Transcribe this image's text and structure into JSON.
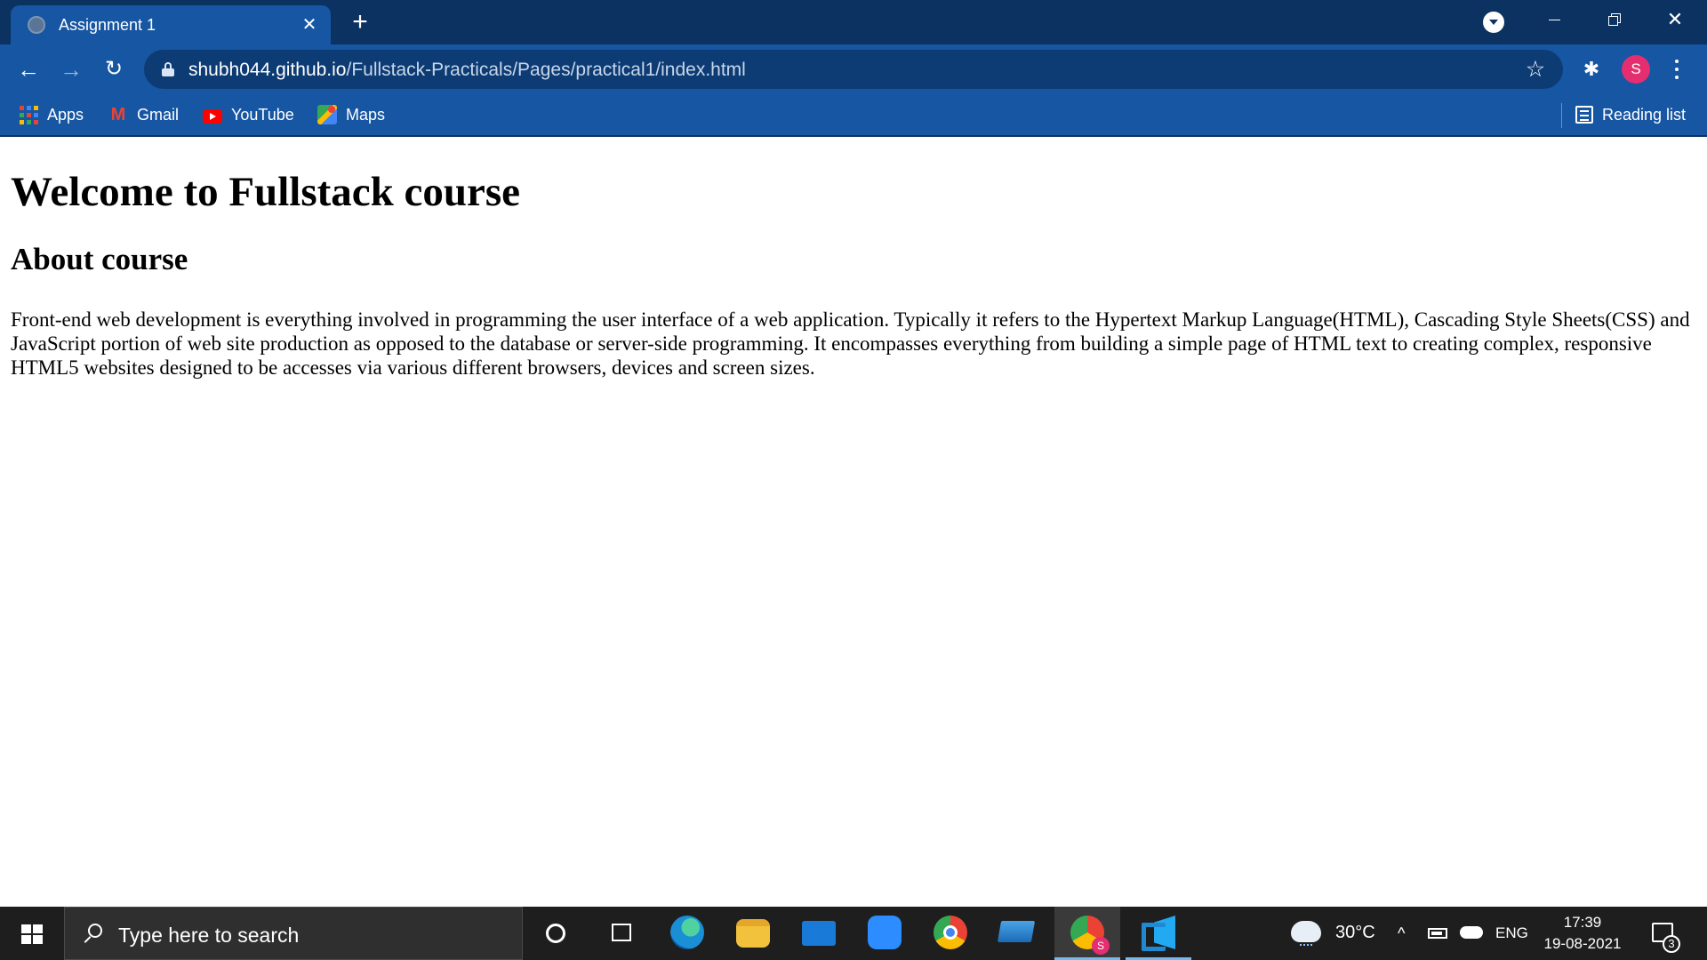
{
  "browser": {
    "tab": {
      "title": "Assignment 1",
      "close": "✕"
    },
    "new_tab": "+",
    "toolbar": {
      "back": "←",
      "forward": "→",
      "reload": "↻",
      "url_host": "shubh044.github.io",
      "url_path": "/Fullstack-Practicals/Pages/practical1/index.html",
      "bookmark_star": "☆",
      "extensions": "✱",
      "profile_initial": "S"
    },
    "bookmarks": [
      {
        "label": "Apps",
        "icon": "apps-grid-icon"
      },
      {
        "label": "Gmail",
        "icon": "gmail-icon",
        "glyph": "M"
      },
      {
        "label": "YouTube",
        "icon": "youtube-icon"
      },
      {
        "label": "Maps",
        "icon": "maps-icon"
      }
    ],
    "reading_list": "Reading list",
    "window_close": "✕"
  },
  "page": {
    "heading": "Welcome to Fullstack course",
    "subheading": "About course",
    "paragraph": "Front-end web development is everything involved in programming the user interface of a web application. Typically it refers to the Hypertext Markup Language(HTML), Cascading Style Sheets(CSS) and JavaScript portion of web site production as opposed to the database or server-side programming. It encompasses everything from building a simple page of HTML text to creating complex, responsive HTML5 websites designed to be accesses via various different browsers, devices and screen sizes."
  },
  "taskbar": {
    "search_placeholder": "Type here to search",
    "apps": [
      "cortana-icon",
      "task-view-icon",
      "edge-icon",
      "file-explorer-icon",
      "mail-icon",
      "zoom-icon",
      "chrome-icon",
      "laptop-app-icon",
      "chrome-active-icon",
      "vscode-icon"
    ],
    "chrome_badge": "S",
    "weather_temp": "30°C",
    "tray_chevron": "^",
    "language": "ENG",
    "time": "17:39",
    "date": "19-08-2021",
    "notification_count": "3"
  },
  "colors": {
    "tabstrip": "#0b3260",
    "toolbar": "#1656a2",
    "taskbar": "#1e1e1e",
    "profile": "#e52e6f"
  }
}
